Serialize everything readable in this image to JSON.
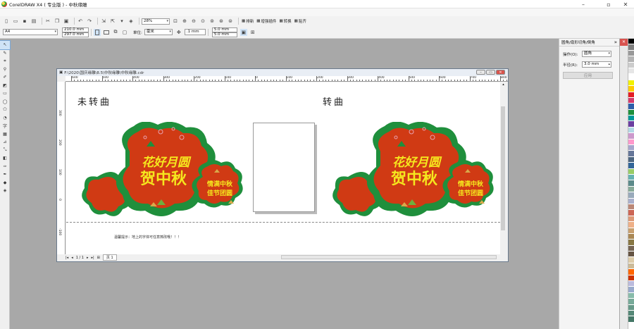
{
  "window": {
    "title": "CorelDRAW X4 ( 专业版 ) - 中秋缘雕"
  },
  "standard_toolbar": {
    "zoom_value": "28%",
    "snap_label": "贴齐",
    "launcher_label": "排新",
    "plugin_label": "增强插件",
    "convert_label": "转换",
    "paste_label": "贴齐"
  },
  "property_bar": {
    "page_preset": "A4",
    "width": "210.0 mm",
    "height": "297.0 mm",
    "unit_label": "单位:",
    "unit_value": "毫米",
    "nudge": ".1 mm",
    "dup_x": "5.0 mm",
    "dup_y": "5.0 mm"
  },
  "document": {
    "title": "F:\\2020\\国庆缘雕\\8.5\\中秋缘雕\\中秋缘雕.cdr",
    "ruler_h": [
      "600",
      "500",
      "400",
      "300",
      "200",
      "100",
      "0",
      "100",
      "200",
      "300",
      "400",
      "500",
      "600",
      "700",
      "800"
    ],
    "ruler_v": [
      "300",
      "200",
      "100",
      "0",
      "-100"
    ],
    "label_left": "未转曲",
    "label_right": "转曲",
    "tip": "温馨提示：地上的字体可任意擦改哦！！！",
    "page_nav": "1 / 1",
    "page_tab": "页 1",
    "sign": {
      "line1": "花好月圆",
      "line2": "贺中秋",
      "small1": "情满中秋",
      "small2": "佳节团圆"
    }
  },
  "docker": {
    "title": "圆角/扇形切角/倒角",
    "op_label": "操作(O):",
    "op_value": "圆角",
    "radius_label": "半径(R):",
    "radius_value": "3.0 mm",
    "apply_label": "应用"
  },
  "palette": [
    "#000000",
    "#808080",
    "#999999",
    "#b3b3b3",
    "#cccccc",
    "#e6e6e6",
    "#ffffff",
    "#f2f200",
    "#ffcc00",
    "#e31e24",
    "#d43b6b",
    "#2e5faa",
    "#1f8f3c",
    "#009999",
    "#6b3fa0",
    "#b3d9e6",
    "#cc99cc",
    "#ff99cc",
    "#a6a6cc",
    "#667799",
    "#4d6680",
    "#336699",
    "#99cc66",
    "#66b2b2",
    "#5c8a8a",
    "#88aa99",
    "#99aabb",
    "#aab0cc",
    "#bb8877",
    "#cc6655",
    "#dd9977",
    "#eeb088",
    "#c8a070",
    "#aa8855",
    "#887744",
    "#776655",
    "#665544",
    "#ddccaa",
    "#ccbb99",
    "#ff6600",
    "#cc3300",
    "#bbbbdd",
    "#99aacc",
    "#88bbaa",
    "#77aa99",
    "#669988",
    "#558877",
    "#447766"
  ],
  "colors": {
    "sign_red": "#d03a14",
    "sign_green": "#1f8f3c",
    "sign_gold": "#f5e71e"
  }
}
